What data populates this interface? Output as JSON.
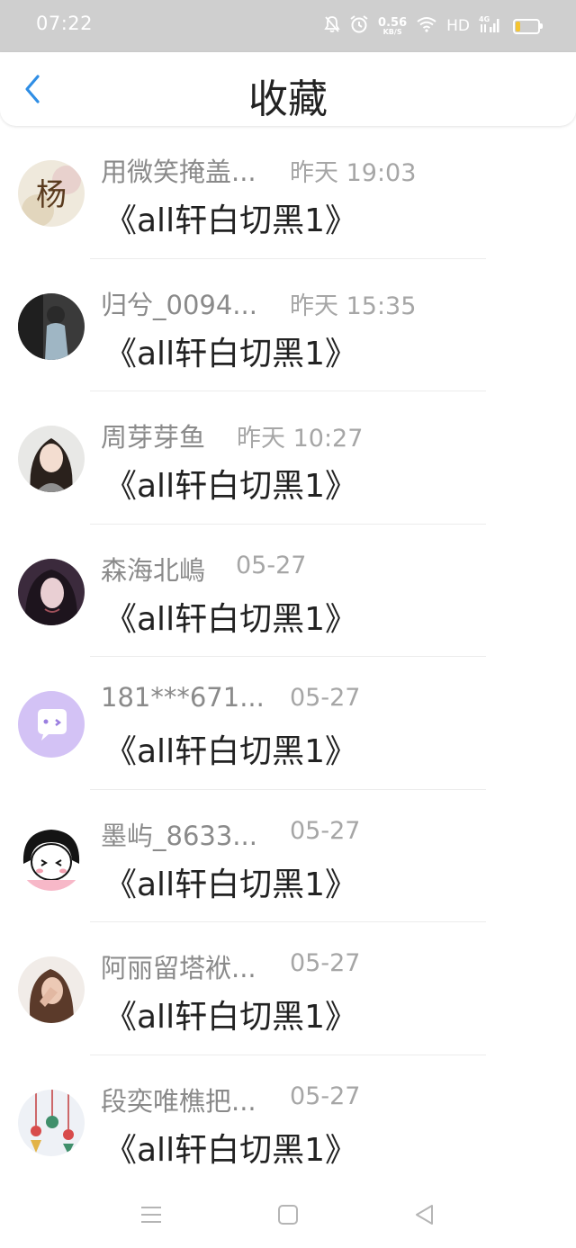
{
  "status_bar": {
    "time": "07:22",
    "net_speed": "0.56",
    "net_unit": "KB/S",
    "hd": "HD",
    "signal_type": "4G"
  },
  "header": {
    "title": "收藏"
  },
  "items": [
    {
      "name": "用微笑掩盖...",
      "time": "昨天 19:03",
      "content": "《all轩白切黑1》"
    },
    {
      "name": "归兮_0094...",
      "time": "昨天 15:35",
      "content": "《all轩白切黑1》"
    },
    {
      "name": "周芽芽鱼",
      "time": "昨天 10:27",
      "content": "《all轩白切黑1》"
    },
    {
      "name": "森海北嶋",
      "time": "05-27",
      "content": "《all轩白切黑1》"
    },
    {
      "name": "181***671...",
      "time": "05-27",
      "content": "《all轩白切黑1》"
    },
    {
      "name": "墨屿_8633...",
      "time": "05-27",
      "content": "《all轩白切黑1》"
    },
    {
      "name": "阿丽留塔袱...",
      "time": "05-27",
      "content": "《all轩白切黑1》"
    },
    {
      "name": "段奕唯樵把...",
      "time": "05-27",
      "content": "《all轩白切黑1》"
    }
  ],
  "avatar_1_text": "杨",
  "colors": {
    "accent": "#2f8ee5",
    "battery": "#f4c431",
    "status_bg": "#cfcfcf",
    "avatar_bubble": "#d3c2f5"
  }
}
